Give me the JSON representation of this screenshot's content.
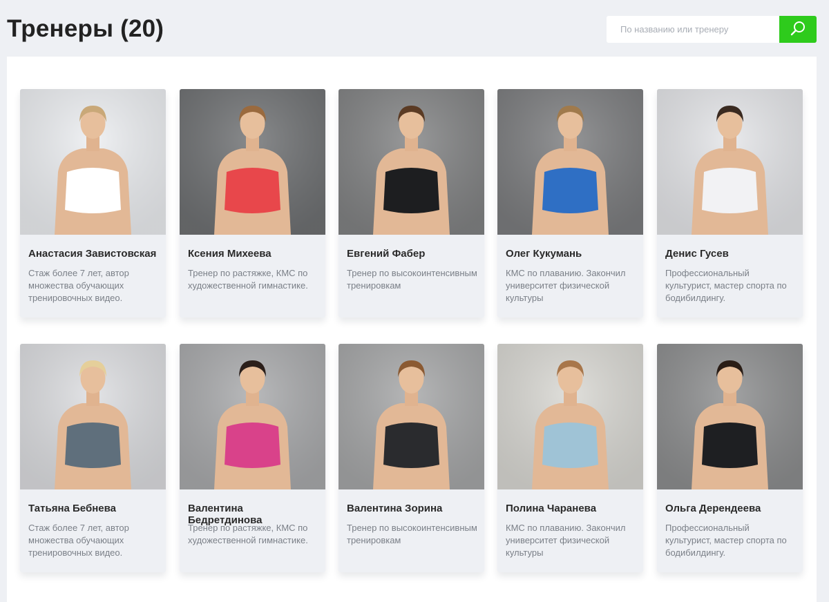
{
  "header": {
    "title": "Тренеры (20)"
  },
  "search": {
    "placeholder": "По названию или тренеру",
    "button_icon": "search-icon",
    "button_color": "#2ecb1c"
  },
  "trainers": [
    {
      "name": "Анастасия Завистовская",
      "description": "Стаж более 7 лет, автор множества обучающих тренировочных видео.",
      "bg": "#eceef1",
      "outfit": "#ffffff",
      "hair": "#c9a878"
    },
    {
      "name": "Ксения Михеева",
      "description": "Тренер по растяжке, КМС по художественной гимнастике.",
      "bg": "#6f7173",
      "outfit": "#e8474b",
      "hair": "#9a6a3e"
    },
    {
      "name": "Евгений Фабер",
      "description": "Тренер по высокоинтенсивным тренировкам",
      "bg": "#828384",
      "outfit": "#1d1e20",
      "hair": "#5b3b24"
    },
    {
      "name": "Олег Кукумань",
      "description": "КМС по плаванию. Закончил университет физической культуры",
      "bg": "#7c7d7f",
      "outfit": "#2f6fc4",
      "hair": "#a07a4c"
    },
    {
      "name": "Денис Гусев",
      "description": "Профессиональный культурист, мастер спорта по бодибилдингу.",
      "bg": "#e4e5e8",
      "outfit": "#f2f2f4",
      "hair": "#3a2a20"
    },
    {
      "name": "Татьяна Бебнева",
      "description": "Стаж более 7 лет, автор множества обучающих тренировочных видео.",
      "bg": "#dcdde0",
      "outfit": "#5f6f7c",
      "hair": "#e5cf9a"
    },
    {
      "name": "Валентина Бедретдинова",
      "description": "Тренер по растяжке, КМС по художественной гимнастике.",
      "bg": "#a9aaac",
      "outfit": "#d9428a",
      "hair": "#2b1f1a"
    },
    {
      "name": "Валентина Зорина",
      "description": "Тренер по высокоинтенсивным тренировкам",
      "bg": "#a6a7a8",
      "outfit": "#2a2b2e",
      "hair": "#8b5a32"
    },
    {
      "name": "Полина Чаранева",
      "description": "КМС по плаванию. Закончил университет физической культуры",
      "bg": "#d9d8d3",
      "outfit": "#9fc3d6",
      "hair": "#a8764a"
    },
    {
      "name": "Ольга Дерендеева",
      "description": "Профессиональный культурист, мастер спорта по бодибилдингу.",
      "bg": "#8d8e8f",
      "outfit": "#1e1f22",
      "hair": "#2a1d16"
    }
  ]
}
